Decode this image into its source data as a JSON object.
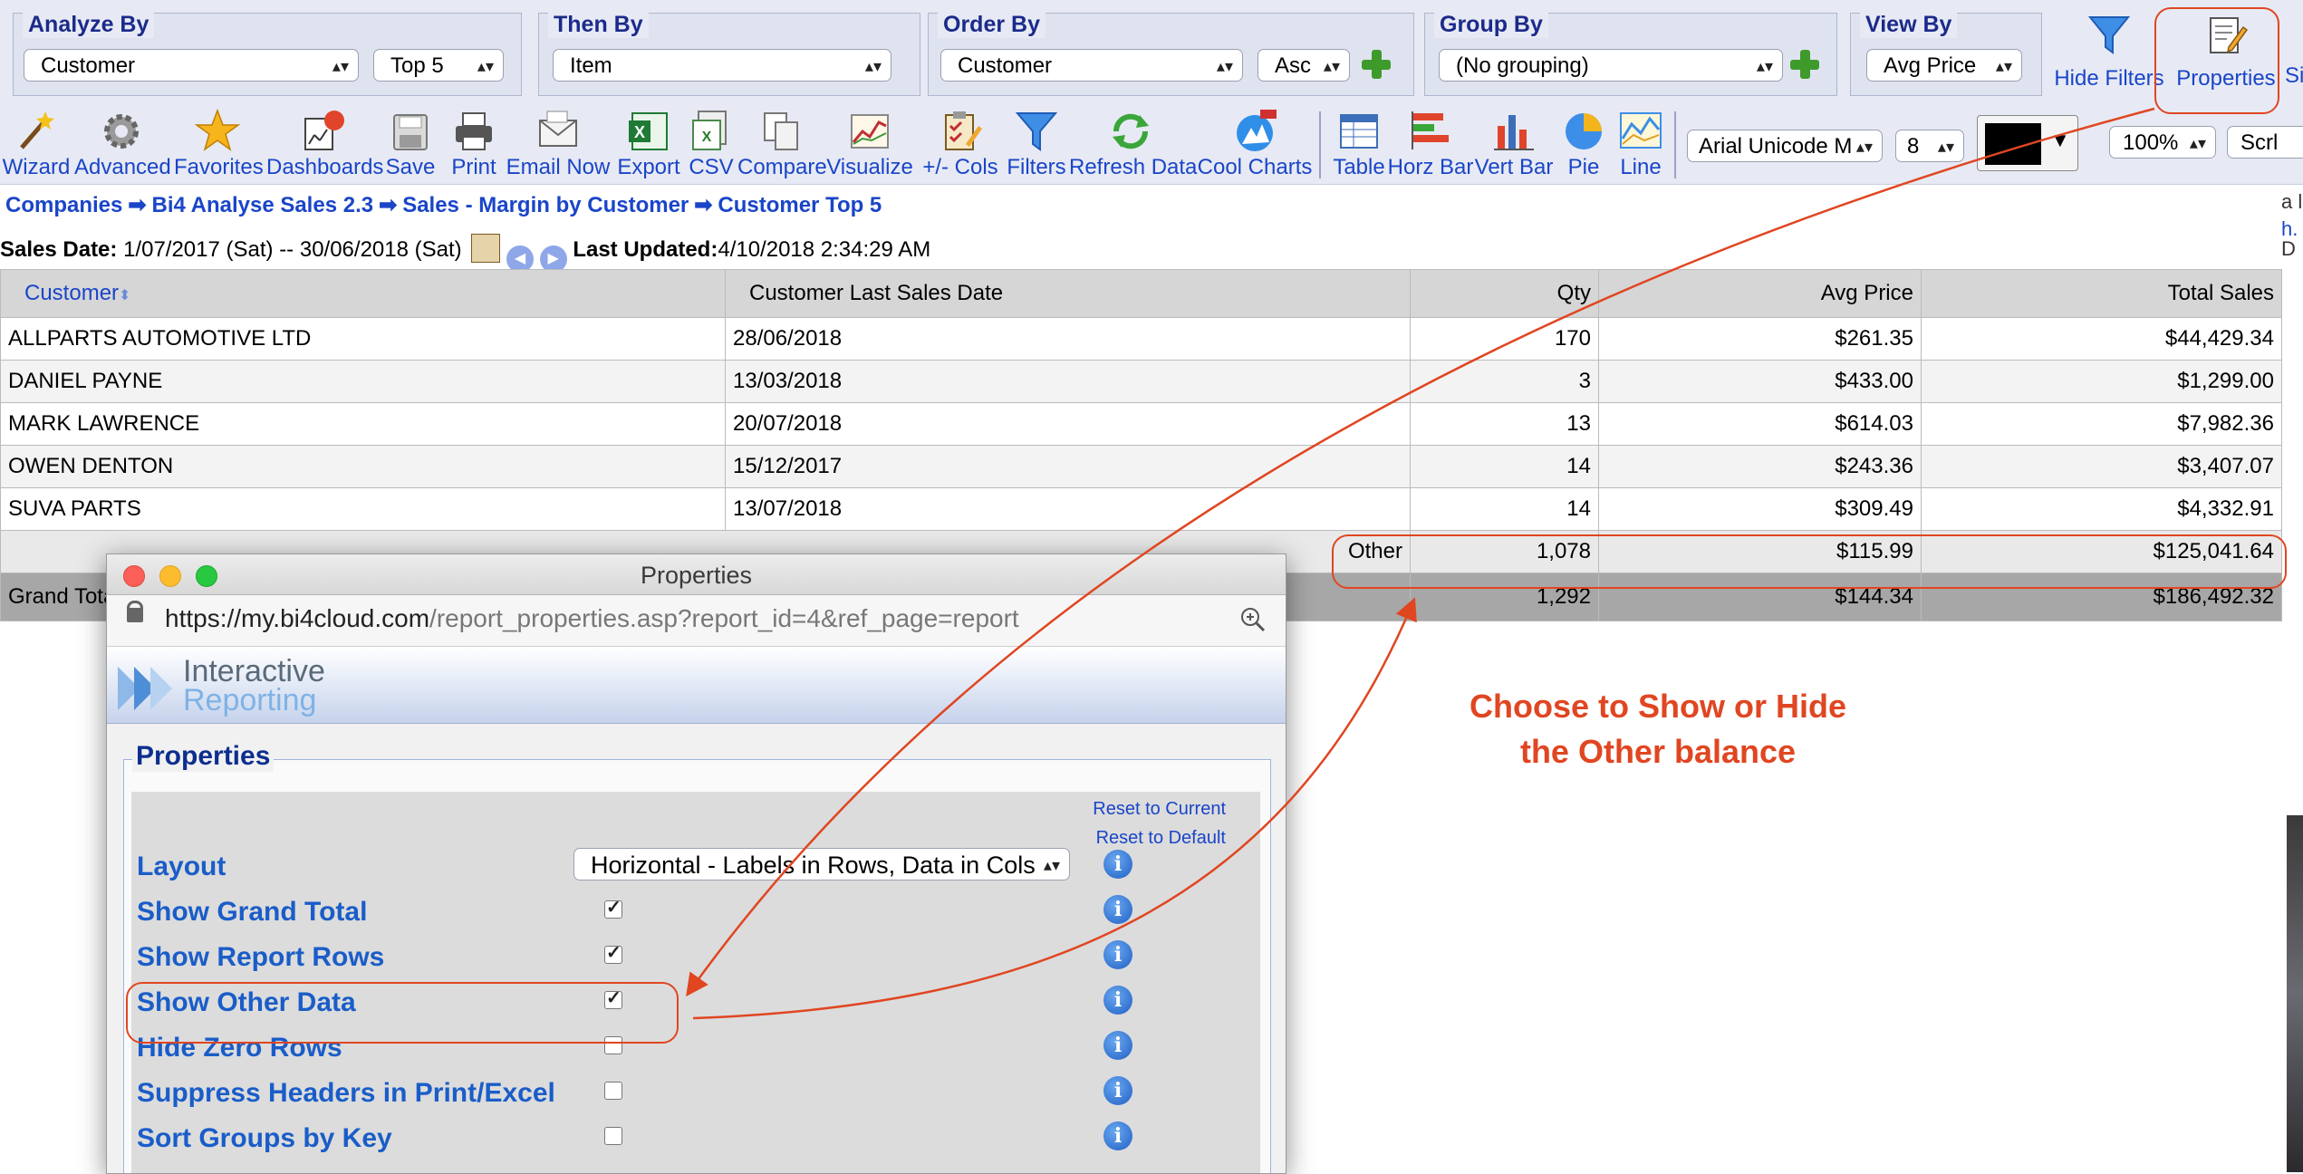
{
  "filters": {
    "analyze_by": {
      "label": "Analyze By",
      "value": "Customer",
      "top": "Top 5"
    },
    "then_by": {
      "label": "Then By",
      "value": "Item"
    },
    "order_by": {
      "label": "Order By",
      "value": "Customer",
      "direction": "Asc"
    },
    "group_by": {
      "label": "Group By",
      "value": "(No grouping)"
    },
    "view_by": {
      "label": "View By",
      "value": "Avg Price"
    },
    "hide_filters_label": "Hide Filters",
    "properties_label": "Properties",
    "cut_label": "Si"
  },
  "toolbar": {
    "wizard": "Wizard",
    "advanced": "Advanced",
    "favorites": "Favorites",
    "dashboards": "Dashboards",
    "save": "Save",
    "print": "Print",
    "email_now": "Email Now",
    "export": "Export",
    "csv": "CSV",
    "compare": "Compare",
    "visualize": "Visualize",
    "cols": "+/- Cols",
    "filters": "Filters",
    "refresh": "Refresh Data",
    "cool_charts": "Cool Charts",
    "table": "Table",
    "horz_bar": "Horz Bar",
    "vert_bar": "Vert Bar",
    "pie": "Pie",
    "line": "Line",
    "font_name": "Arial Unicode M",
    "font_size": "8",
    "zoom": "100%",
    "scroll": "Scrl"
  },
  "breadcrumb": [
    "Companies",
    "Bi4 Analyse Sales 2.3",
    "Sales - Margin by Customer",
    "Customer Top 5"
  ],
  "dates": {
    "sales_label": "Sales Date:",
    "range": "1/07/2017 (Sat) -- 30/06/2018 (Sat)",
    "updated_label": "Last Updated:",
    "updated": "4/10/2018 2:34:29 AM"
  },
  "table": {
    "headers": [
      "Customer",
      "Customer Last Sales Date",
      "Qty",
      "Avg Price",
      "Total Sales"
    ],
    "rows": [
      [
        "ALLPARTS AUTOMOTIVE LTD",
        "28/06/2018",
        "170",
        "$261.35",
        "$44,429.34"
      ],
      [
        "DANIEL PAYNE",
        "13/03/2018",
        "3",
        "$433.00",
        "$1,299.00"
      ],
      [
        "MARK LAWRENCE",
        "20/07/2018",
        "13",
        "$614.03",
        "$7,982.36"
      ],
      [
        "OWEN DENTON",
        "15/12/2017",
        "14",
        "$243.36",
        "$3,407.07"
      ],
      [
        "SUVA PARTS",
        "13/07/2018",
        "14",
        "$309.49",
        "$4,332.91"
      ]
    ],
    "other": {
      "label": "Other",
      "qty": "1,078",
      "avg": "$115.99",
      "total": "$125,041.64"
    },
    "grand": {
      "label": "Grand Tota",
      "qty": "1,292",
      "avg": "$144.34",
      "total": "$186,492.32"
    }
  },
  "properties_window": {
    "title": "Properties",
    "url_host": "https://my.bi4cloud.com",
    "url_path": "/report_properties.asp?report_id=4&ref_page=report",
    "logo_line1": "Interactive",
    "logo_line2": "Reporting",
    "section_title": "Properties",
    "reset_current": "Reset to Current",
    "reset_default": "Reset to Default",
    "layout_label": "Layout",
    "layout_value": "Horizontal - Labels in Rows, Data in Cols",
    "options": [
      {
        "label": "Show Grand Total",
        "checked": true
      },
      {
        "label": "Show Report Rows",
        "checked": true
      },
      {
        "label": "Show Other Data",
        "checked": true
      },
      {
        "label": "Hide Zero Rows",
        "checked": false
      },
      {
        "label": "Suppress Headers in Print/Excel",
        "checked": false
      },
      {
        "label": "Sort Groups by Key",
        "checked": false
      }
    ]
  },
  "annotation": {
    "line1": "Choose to Show or Hide",
    "line2": "the Other balance"
  },
  "colors": {
    "accent": "#1a45c8",
    "annotation": "#e04621",
    "header_bg": "#d6d6d6"
  },
  "right_edge": {
    "t1": "a l",
    "t2": "h.",
    "t3": "D"
  }
}
